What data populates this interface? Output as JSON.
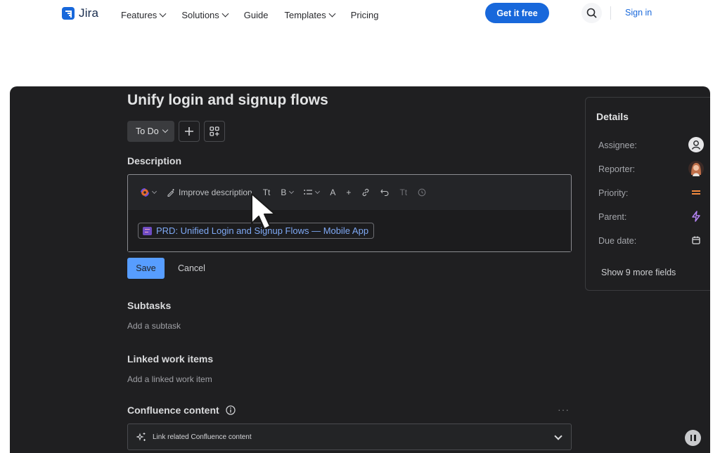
{
  "nav": {
    "brand": "Jira",
    "links": [
      {
        "label": "Features",
        "dropdown": true
      },
      {
        "label": "Solutions",
        "dropdown": true
      },
      {
        "label": "Guide",
        "dropdown": false
      },
      {
        "label": "Templates",
        "dropdown": true
      },
      {
        "label": "Pricing",
        "dropdown": false
      }
    ],
    "cta_label": "Get it free",
    "signin_label": "Sign in",
    "search_icon": "search-icon"
  },
  "issue": {
    "title": "Unify login and signup flows",
    "status": "To Do",
    "description_heading": "Description",
    "toolbar": {
      "improve_label": "Improve description",
      "text_style": "Tt",
      "bold": "B",
      "color": "A",
      "insert": "+",
      "format_small": "Tt"
    },
    "linked_page": "PRD: Unified Login and Signup Flows — Mobile App",
    "save_label": "Save",
    "cancel_label": "Cancel",
    "subtasks_heading": "Subtasks",
    "subtasks_placeholder": "Add a subtask",
    "linked_heading": "Linked work items",
    "linked_placeholder": "Add a linked work item",
    "confluence_heading": "Confluence content",
    "confluence_action": "Link related Confluence content",
    "more": "···"
  },
  "details": {
    "title": "Details",
    "fields": [
      {
        "label": "Assignee:",
        "icon": "unassigned-avatar-icon"
      },
      {
        "label": "Reporter:",
        "icon": "reporter-avatar"
      },
      {
        "label": "Priority:",
        "icon": "priority-medium-icon"
      },
      {
        "label": "Parent:",
        "icon": "epic-lightning-icon"
      },
      {
        "label": "Due date:",
        "icon": "calendar-icon"
      }
    ],
    "show_more": "Show 9 more fields"
  },
  "colors": {
    "brand_blue": "#1868db",
    "dark_bg": "#1f1f21",
    "save_blue": "#579dff",
    "priority_orange": "#f38a3f",
    "epic_purple": "#b383f2"
  }
}
